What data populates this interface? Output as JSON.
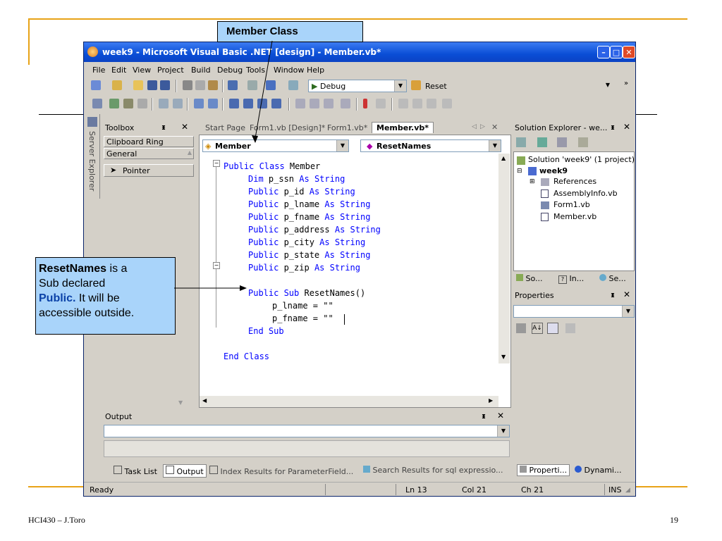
{
  "slide": {
    "footer_author": "HCI430 – J.Toro",
    "page_number": "19",
    "accent_color": "#E8A317"
  },
  "callouts": {
    "member_class": "Member Class",
    "reset_names": {
      "part1_bold": "ResetNames",
      "part1_rest": " is a",
      "line2": "Sub declared",
      "line3_bold": "Public.",
      "line3_rest": " It will be",
      "line4": "accessible outside."
    }
  },
  "window": {
    "title": "week9 - Microsoft Visual Basic .NET [design] - Member.vb*",
    "menu": [
      "File",
      "Edit",
      "View",
      "Project",
      "Build",
      "Debug",
      "Tools",
      "Window",
      "Help"
    ],
    "config_combo": "Debug",
    "find_combo": "Reset"
  },
  "toolbox": {
    "title": "Toolbox",
    "side_tab": "Server Explorer",
    "sections": [
      "Clipboard Ring",
      "General"
    ],
    "items": [
      "Pointer"
    ]
  },
  "editor": {
    "tabs": [
      "Start Page",
      "Form1.vb [Design]*",
      "Form1.vb*",
      "Member.vb*"
    ],
    "active_tab": "Member.vb*",
    "class_combo": "Member",
    "method_combo": "ResetNames",
    "code": [
      {
        "kw": "Public Class",
        "rest": " Member"
      },
      {
        "kw": "Dim",
        "rest": " p_ssn ",
        "kw2": "As String"
      },
      {
        "kw": "Public",
        "rest": " p_id ",
        "kw2": "As String"
      },
      {
        "kw": "Public",
        "rest": " p_lname ",
        "kw2": "As String"
      },
      {
        "kw": "Public",
        "rest": " p_fname ",
        "kw2": "As String"
      },
      {
        "kw": "Public",
        "rest": " p_address ",
        "kw2": "As String"
      },
      {
        "kw": "Public",
        "rest": " p_city ",
        "kw2": "As String"
      },
      {
        "kw": "Public",
        "rest": " p_state ",
        "kw2": "As String"
      },
      {
        "kw": "Public",
        "rest": " p_zip ",
        "kw2": "As String"
      },
      {
        "kw": "Public Sub",
        "rest": " ResetNames()"
      },
      {
        "plain": "p_lname = \"\""
      },
      {
        "plain": "p_fname = \"\""
      },
      {
        "kw": "End Sub"
      },
      {
        "kw": "End Class"
      }
    ]
  },
  "solution_explorer": {
    "title": "Solution Explorer - we...",
    "solution": "Solution 'week9' (1 project)",
    "project": "week9",
    "items": [
      "References",
      "AssemblyInfo.vb",
      "Form1.vb",
      "Member.vb"
    ],
    "tabs": [
      "So...",
      "In...",
      "Se..."
    ]
  },
  "properties": {
    "title": "Properties"
  },
  "output": {
    "title": "Output"
  },
  "bottom_tabs": [
    "Task List",
    "Output",
    "Index Results for ParameterField...",
    "Search Results for sql expressio...",
    "Properti...",
    "Dynami..."
  ],
  "status": {
    "text": "Ready",
    "ln": "Ln 13",
    "col": "Col 21",
    "ch": "Ch 21",
    "ins": "INS"
  }
}
